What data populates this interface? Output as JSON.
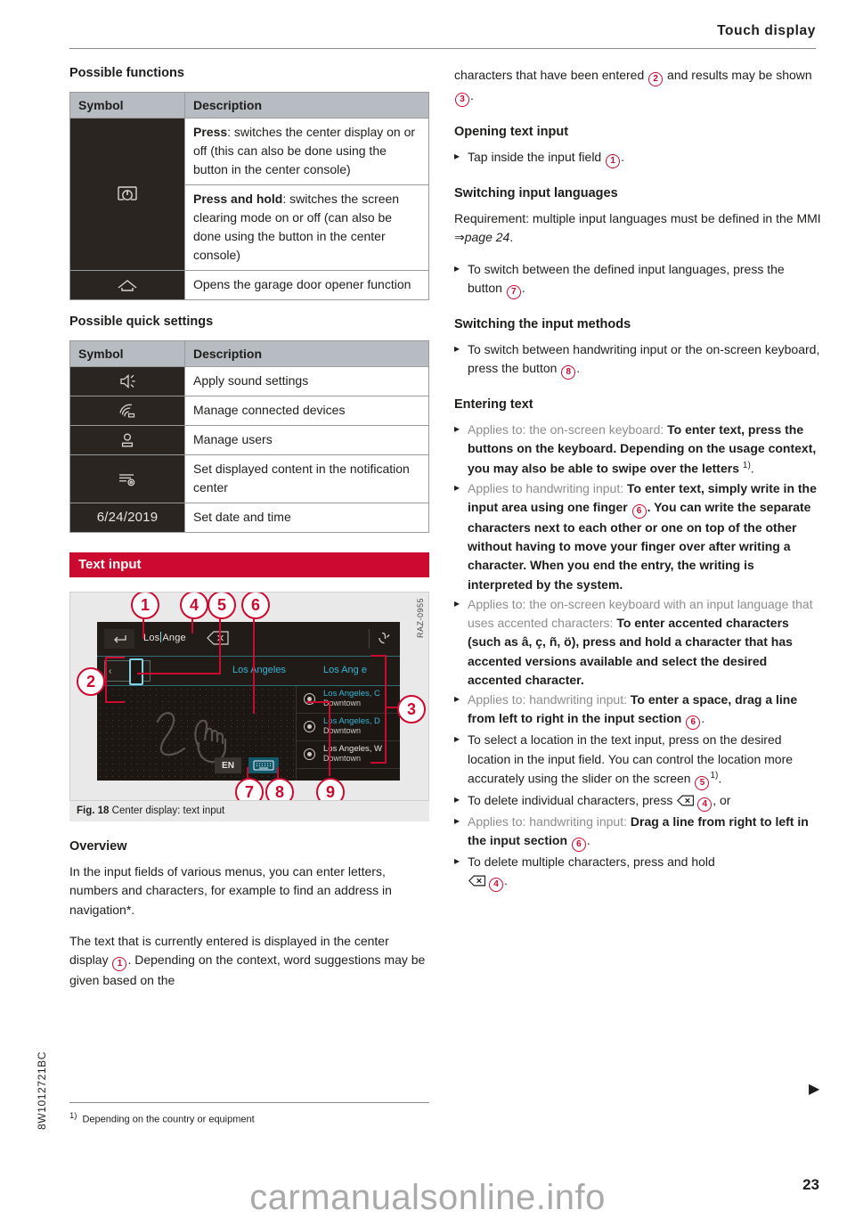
{
  "header": {
    "title": "Touch display"
  },
  "left": {
    "functions_heading": "Possible functions",
    "functions_table": {
      "col_symbol": "Symbol",
      "col_description": "Description",
      "rows": [
        {
          "icon": "display-power-icon",
          "descriptions": [
            {
              "bold": "Press",
              "rest": ": switches the center display on or off (this can also be done using the button in the center console)"
            },
            {
              "bold": "Press and hold",
              "rest": ": switches the screen clearing mode on or off (can also be done using the button in the center console)"
            }
          ]
        },
        {
          "icon": "garage-door-icon",
          "descriptions": [
            {
              "bold": "",
              "rest": "Opens the garage door opener function"
            }
          ]
        }
      ]
    },
    "quick_heading": "Possible quick settings",
    "quick_table": {
      "col_symbol": "Symbol",
      "col_description": "Description",
      "rows": [
        {
          "icon": "speaker-icon",
          "text": "",
          "description": "Apply sound settings"
        },
        {
          "icon": "wifi-device-icon",
          "text": "",
          "description": "Manage connected devices"
        },
        {
          "icon": "user-icon",
          "text": "",
          "description": "Manage users"
        },
        {
          "icon": "notification-settings-icon",
          "text": "",
          "description": "Set displayed content in the notification center"
        },
        {
          "icon": "date-text",
          "text": "6/24/2019",
          "description": "Set date and time"
        }
      ]
    },
    "banner": "Text input",
    "figure": {
      "code": "RAZ-0955",
      "caption_label": "Fig. 18",
      "caption_text": "Center display: text input",
      "screen": {
        "back_icon": "back-arrow-icon",
        "input_value": "Los",
        "input_value_2": "Ange",
        "delete_icon": "delete-backspace-icon",
        "mic_icon": "voice-input-icon",
        "slider_prev": "‹",
        "suggestion_1": "Los Angeles",
        "suggestion_2": "Los Ang e",
        "language_button": "EN",
        "keyboard_icon": "keyboard-icon",
        "handwriting_icon": "handwriting-finger-icon",
        "results": [
          {
            "line1": "Los Angeles, C",
            "line2": "Downtown",
            "style": "hl"
          },
          {
            "line1": "Los Angeles, D",
            "line2": "Downtown",
            "style": "hl"
          },
          {
            "line1": "Los Angeles, W",
            "line2": "Downtown",
            "style": "pl"
          }
        ]
      },
      "callouts": [
        "1",
        "2",
        "3",
        "4",
        "5",
        "6",
        "7",
        "8",
        "9"
      ]
    },
    "overview_heading": "Overview",
    "overview_p1": "In the input fields of various menus, you can enter letters, numbers and characters, for example to find an address in navigation*.",
    "overview_p2_a": "The text that is currently entered is displayed in the center display ",
    "overview_p2_ref": "1",
    "overview_p2_b": ". Depending on the context, word suggestions may be given based on the"
  },
  "right": {
    "cont_a": "characters that have been entered ",
    "cont_ref_1": "2",
    "cont_b": " and results may be shown ",
    "cont_ref_2": "3",
    "cont_c": ".",
    "opening_heading": "Opening text input",
    "opening_bullet_a": "Tap inside the input field ",
    "opening_bullet_ref": "1",
    "opening_bullet_b": ".",
    "switch_lang_heading": "Switching input languages",
    "switch_lang_req_a": "Requirement: multiple input languages must be defined in the MMI ",
    "switch_lang_req_arrow": "⇒",
    "switch_lang_req_page": "page 24",
    "switch_lang_req_b": ".",
    "switch_lang_bullet_a": "To switch between the defined input languages, press the button ",
    "switch_lang_bullet_ref": "7",
    "switch_lang_bullet_b": ".",
    "switch_method_heading": "Switching the input methods",
    "switch_method_bullet_a": "To switch between handwriting input or the on-screen keyboard, press the button ",
    "switch_method_bullet_ref": "8",
    "switch_method_bullet_b": ".",
    "entering_heading": "Entering text",
    "bullets": [
      {
        "cond": "Applies to: the on-screen keyboard: ",
        "bold": "To enter text, press the buttons on the keyboard. Depending on the usage context, you may also be able to swipe over the letters ",
        "footnote": "1)",
        "tail": "."
      },
      {
        "cond": "Applies to handwriting input: ",
        "bold": "To enter text, simply write in the input area using one finger ",
        "ref": "6",
        "bold2": ". You can write the separate characters next to each other or one on top of the other without having to move your finger over after writing a character. When you end the entry, the writing is interpreted by the system."
      },
      {
        "cond": "Applies to: the on-screen keyboard with an input language that uses accented characters: ",
        "bold": "To enter accented characters (such as â, ç, ñ, ö), press and hold a character that has accented versions available and select the desired accented character."
      },
      {
        "cond": "Applies to: handwriting input: ",
        "bold": "To enter a space, drag a line from left to right in the input section ",
        "ref": "6",
        "tail": "."
      },
      {
        "plain_a": "To select a location in the text input, press on the desired location in the input field. You can control the location more accurately using the slider on the screen ",
        "ref": "5",
        "footnote": "1)",
        "tail": "."
      },
      {
        "plain_a": "To delete individual characters, press ",
        "icon": "delete-backspace-icon",
        "ref": "4",
        "tail": ", or"
      },
      {
        "cond": "Applies to: handwriting input: ",
        "bold": "Drag a line from right to left in the input section ",
        "ref": "6",
        "tail": "."
      },
      {
        "plain_a": "To delete multiple characters, press and hold ",
        "icon": "delete-backspace-icon",
        "ref": "4",
        "tail": "."
      }
    ]
  },
  "footer": {
    "spine_code": "8W1012721BC",
    "footnote_marker": "1)",
    "footnote_text": "Depending on the country or equipment",
    "page_number": "23",
    "watermark": "carmanualsonline.info",
    "continuation_arrow": "▶"
  }
}
